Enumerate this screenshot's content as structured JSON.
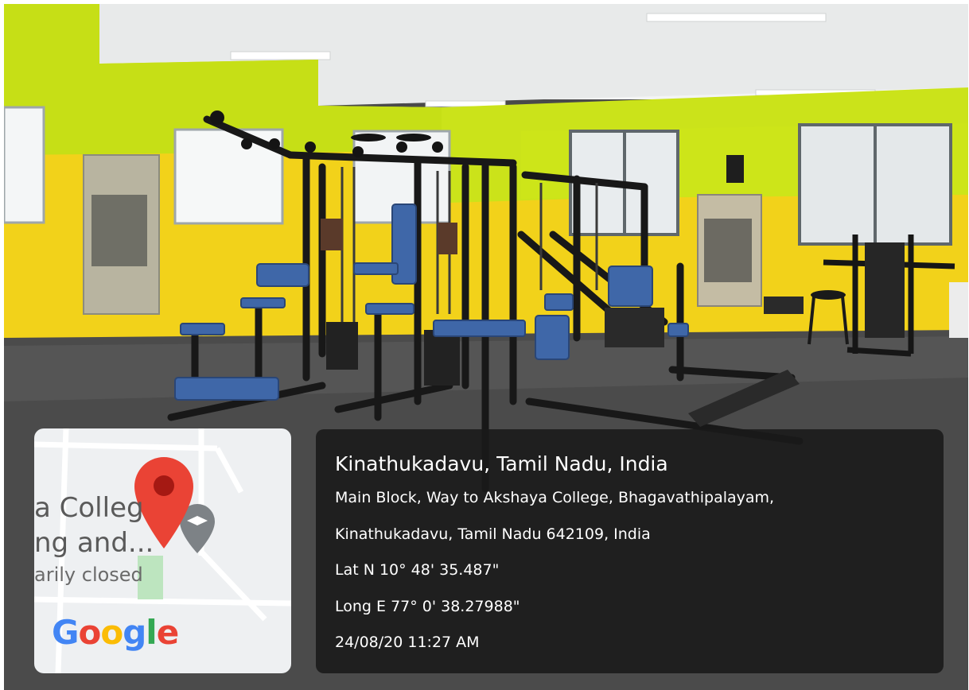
{
  "map": {
    "label_line1": "a Colleg",
    "label_line2": "ng and...",
    "label_line3": "arily closed",
    "logo_letters": [
      "G",
      "o",
      "o",
      "g",
      "l",
      "e"
    ],
    "pin_color": "#EA4335",
    "secondary_pin_color": "#7d8286"
  },
  "stamp": {
    "place": "Kinathukadavu, Tamil Nadu, India",
    "address_line1": "Main Block, Way to Akshaya College, Bhagavathipalayam,",
    "address_line2": "Kinathukadavu, Tamil Nadu 642109, India",
    "latitude": "Lat N 10° 48' 35.487\"",
    "longitude": "Long E 77° 0' 38.27988\"",
    "datetime": "24/08/20 11:27 AM"
  },
  "colors": {
    "wall_yellow": "#f2d21a",
    "wall_green": "#cbe31a",
    "floor": "#4b4b4b",
    "equipment": "#1a1a1a",
    "pad_blue": "#3f67a8"
  }
}
